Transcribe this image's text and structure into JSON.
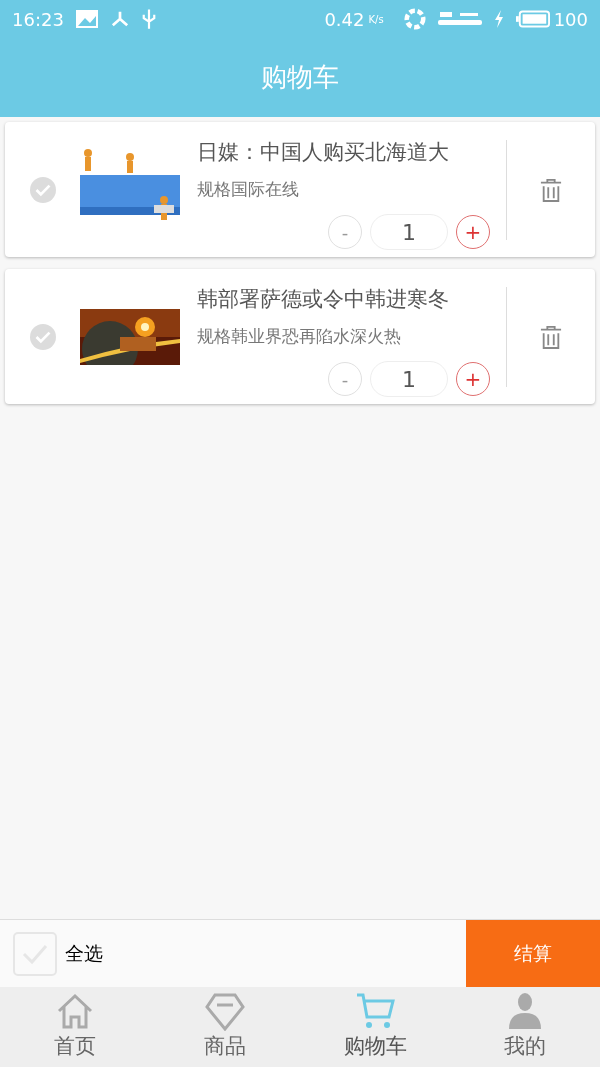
{
  "status_bar": {
    "time": "16:23",
    "speed": "0.42",
    "speed_unit": "K/s",
    "battery": "100"
  },
  "header": {
    "title": "购物车"
  },
  "items": [
    {
      "title": "日媒：中国人购买北海道大",
      "spec": "规格国际在线",
      "quantity": "1",
      "minus": "-",
      "plus": "+",
      "checked": false
    },
    {
      "title": "韩部署萨德或令中韩进寒冬",
      "spec": "规格韩业界恐再陷水深火热",
      "quantity": "1",
      "minus": "-",
      "plus": "+",
      "checked": false
    }
  ],
  "footer": {
    "select_all": {
      "label": "全选",
      "checked": false
    },
    "checkout": "结算"
  },
  "tabs": [
    {
      "label": "首页",
      "kind": "home",
      "selected": false
    },
    {
      "label": "商品",
      "kind": "diamond",
      "selected": false
    },
    {
      "label": "购物车",
      "kind": "cart",
      "selected": true
    },
    {
      "label": "我的",
      "kind": "user",
      "selected": false
    }
  ]
}
